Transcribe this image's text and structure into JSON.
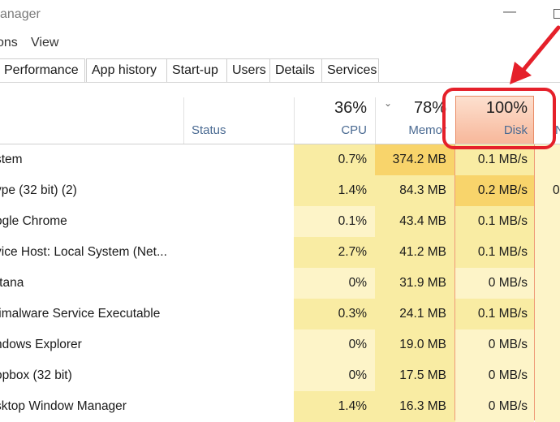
{
  "window": {
    "title": "anager"
  },
  "menu": [
    "ons",
    "View"
  ],
  "tabs": [
    "Performance",
    "App history",
    "Start-up",
    "Users",
    "Details",
    "Services"
  ],
  "columns": {
    "status_label": "Status",
    "cpu": {
      "pct": "36%",
      "label": "CPU"
    },
    "memory": {
      "pct": "78%",
      "label": "Memor"
    },
    "disk": {
      "pct": "100%",
      "label": "Disk"
    },
    "network_label": "N"
  },
  "processes": [
    {
      "name": "stem",
      "cpu": "0.7%",
      "memory": "374.2 MB",
      "disk": "0.1 MB/s",
      "network": ""
    },
    {
      "name": "ype (32 bit) (2)",
      "cpu": "1.4%",
      "memory": "84.3 MB",
      "disk": "0.2 MB/s",
      "network": "0"
    },
    {
      "name": "ogle Chrome",
      "cpu": "0.1%",
      "memory": "43.4 MB",
      "disk": "0.1 MB/s",
      "network": ""
    },
    {
      "name": "vice Host: Local System (Net...",
      "cpu": "2.7%",
      "memory": "41.2 MB",
      "disk": "0.1 MB/s",
      "network": ""
    },
    {
      "name": "rtana",
      "cpu": "0%",
      "memory": "31.9 MB",
      "disk": "0 MB/s",
      "network": ""
    },
    {
      "name": "timalware Service Executable",
      "cpu": "0.3%",
      "memory": "24.1 MB",
      "disk": "0.1 MB/s",
      "network": ""
    },
    {
      "name": "ndows Explorer",
      "cpu": "0%",
      "memory": "19.0 MB",
      "disk": "0 MB/s",
      "network": ""
    },
    {
      "name": "opbox (32 bit)",
      "cpu": "0%",
      "memory": "17.5 MB",
      "disk": "0 MB/s",
      "network": ""
    },
    {
      "name": "sktop Window Manager",
      "cpu": "1.4%",
      "memory": "16.3 MB",
      "disk": "0 MB/s",
      "network": ""
    }
  ],
  "colors": {
    "heat_light": "#fdf4c8",
    "heat_medium": "#f9eca3",
    "heat_strong": "#f8d46b",
    "disk_header": "#f7b79a",
    "annotation": "#e5202a"
  }
}
